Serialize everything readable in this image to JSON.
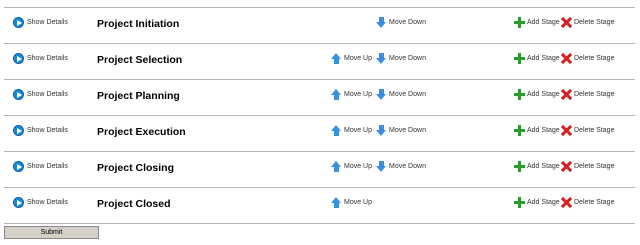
{
  "labels": {
    "show_details": "Show Details",
    "move_up": "Move Up",
    "move_down": "Move Down",
    "add_stage": "Add Stage",
    "delete_stage": "Delete Stage"
  },
  "stages": [
    {
      "name": "Project Initiation",
      "has_move_up": false,
      "has_move_down": true
    },
    {
      "name": "Project Selection",
      "has_move_up": true,
      "has_move_down": true
    },
    {
      "name": "Project Planning",
      "has_move_up": true,
      "has_move_down": true
    },
    {
      "name": "Project Execution",
      "has_move_up": true,
      "has_move_down": true
    },
    {
      "name": "Project Closing",
      "has_move_up": true,
      "has_move_down": true
    },
    {
      "name": "Project Closed",
      "has_move_up": true,
      "has_move_down": false
    }
  ],
  "submit_label": "Submit",
  "colors": {
    "show_icon": "#1e88d8",
    "arrow": "#3b8fe0",
    "add": "#2e9a2e",
    "delete": "#d62020"
  },
  "icons": {
    "show_details": "play-circle-icon",
    "move_up": "arrow-up-icon",
    "move_down": "arrow-down-icon",
    "add_stage": "plus-icon",
    "delete_stage": "delete-x-icon"
  }
}
